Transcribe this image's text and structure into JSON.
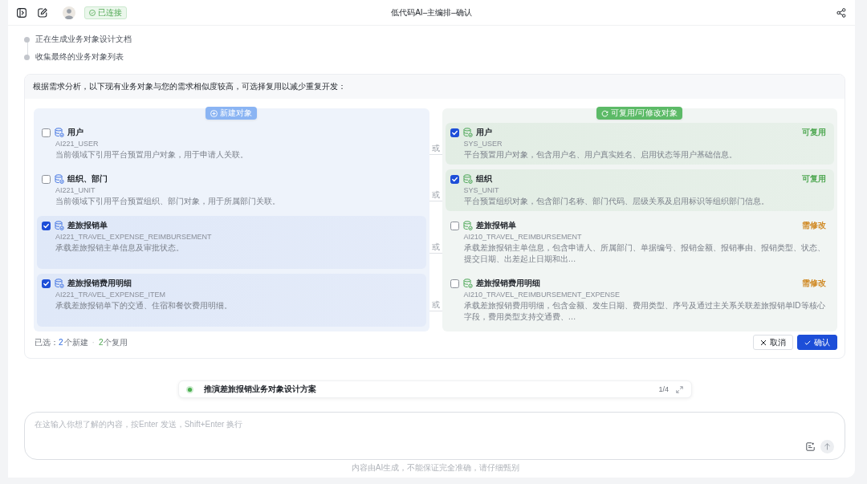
{
  "topbar": {
    "status": "已连接",
    "title": "低代码AI–主编排–确认"
  },
  "steps": [
    {
      "label": "正在生成业务对象设计文档"
    },
    {
      "label": "收集最终的业务对象列表"
    }
  ],
  "comparison": {
    "prompt": "根据需求分析，以下现有业务对象与您的需求相似度较高，可选择复用以减少重复开发：",
    "new_objects": {
      "title": "新建对象",
      "items": [
        {
          "name": "用户",
          "code": "AI221_USER",
          "description": "当前领域下引用平台预置用户对象，用于申请人关联。",
          "checked": false
        },
        {
          "name": "组织、部门",
          "code": "AI221_UNIT",
          "description": "当前领域下引用平台预置组织、部门对象，用于所属部门关联。",
          "checked": false
        },
        {
          "name": "差旅报销单",
          "code": "AI221_TRAVEL_EXPENSE_REIMBURSEMENT",
          "description": "承载差旅报销主单信息及审批状态。",
          "checked": true
        },
        {
          "name": "差旅报销费用明细",
          "code": "AI221_TRAVEL_EXPENSE_ITEM",
          "description": "承载差旅报销单下的交通、住宿和餐饮费用明细。",
          "checked": true
        }
      ]
    },
    "connectors": [
      "或",
      "或",
      "或",
      "或"
    ],
    "reusable_objects": {
      "title": "可复用/可修改对象",
      "items": [
        {
          "name": "用户",
          "code": "SYS_USER",
          "description": "平台预置用户对象，包含用户名、用户真实姓名、启用状态等用户基础信息。",
          "tag": {
            "label": "可复用",
            "color": "#4fa852"
          },
          "checked": true
        },
        {
          "name": "组织",
          "code": "SYS_UNIT",
          "description": "平台预置组织对象，包含部门名称、部门代码、层级关系及启用标识等组织部门信息。",
          "tag": {
            "label": "可复用",
            "color": "#4fa852"
          },
          "checked": true
        },
        {
          "name": "差旅报销单",
          "code": "AI210_TRAVEL_REIMBURSEMENT",
          "description": "承载差旅报销主单信息，包含申请人、所属部门、单据编号、报销金额、报销事由、报销类型、状态、提交日期、出差起止日期和出…",
          "tag": {
            "label": "需修改",
            "color": "#d08a25"
          },
          "checked": false
        },
        {
          "name": "差旅报销费用明细",
          "code": "AI210_TRAVEL_REIMBURSEMENT_EXPENSE",
          "description": "承载差旅报销费用明细，包含金额、发生日期、费用类型、序号及通过主关系关联差旅报销单ID等核心字段，费用类型支持交通费、…",
          "tag": {
            "label": "需修改",
            "color": "#d08a25"
          },
          "checked": false
        }
      ]
    },
    "summary": {
      "label": "已选：",
      "new_count": "2",
      "new_label": "个新建",
      "separator": "·",
      "reuse_count": "2",
      "reuse_label": "个复用"
    },
    "buttons": [
      {
        "label": "取消",
        "kind": "cancel"
      },
      {
        "label": "确认",
        "kind": "confirm"
      }
    ]
  },
  "suggestion": {
    "title": "推演差旅报销业务对象设计方案",
    "pager": "1/4"
  },
  "composer": {
    "placeholder": "在这输入你想了解的内容，按Enter 发送，Shift+Enter 换行"
  },
  "disclaimer": "内容由AI生成，不能保证完全准确，请仔细甄别"
}
